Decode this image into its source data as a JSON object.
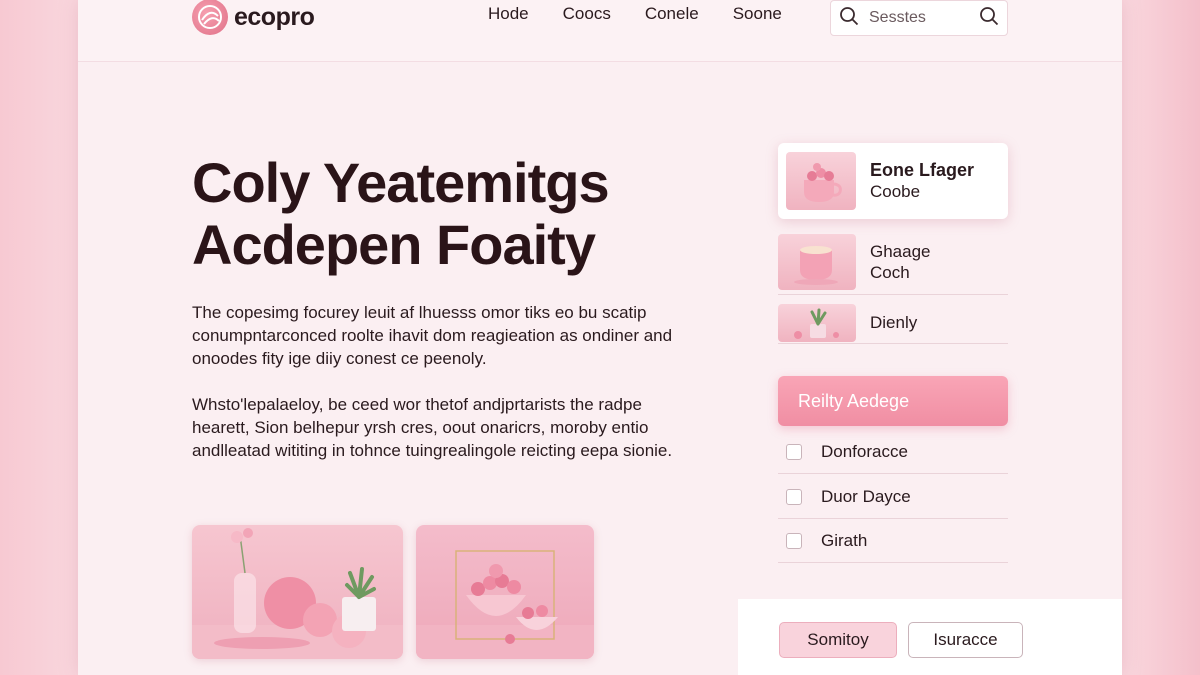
{
  "header": {
    "logo_text": "ecopro",
    "logo_icon": "rose-swirl-icon",
    "nav": [
      "Hode",
      "Coocs",
      "Conele",
      "Soone"
    ],
    "search": {
      "placeholder": "Sesstes",
      "left_icon": "search-icon",
      "right_icon": "search-icon"
    }
  },
  "hero": {
    "title_line1": "Coly Yeatemitgs",
    "title_line2": "Acdepen Foaity",
    "paragraph1": "The copesimg focurey leuit af lhuesss omor tiks eo bu scatip conumpntarconced roolte ihavit dom reagieation as ondiner and onoodes fity ige diiy conest ce peenoly.",
    "paragraph2": "Whsto'lepalaeloy, be ceed wor thetof andjprtarists the radpe hearett, Sion belhepur yrsh cres, oout onaricrs, moroby entio andlleatad wititing in tohnce tuingrealingole reicting eepa sionie."
  },
  "gallery": [
    {
      "alt_icon": "pink-vase-fruit-still-life-image"
    },
    {
      "alt_icon": "pink-bowl-candies-image"
    }
  ],
  "sidebar": {
    "items": [
      {
        "title": "Eone Lfager",
        "subtitle": "Coobe",
        "icon": "teacup-berries-image"
      },
      {
        "title": "Ghaage",
        "subtitle": "Coch",
        "icon": "pink-cup-image"
      },
      {
        "title": "Dienly",
        "subtitle": "",
        "icon": "succulent-pot-image"
      }
    ],
    "cta_label": "Reilty Aedege",
    "checkboxes": [
      {
        "label": "Donforacce",
        "checked": false
      },
      {
        "label": "Duor Dayce",
        "checked": false
      },
      {
        "label": "Girath",
        "checked": false
      }
    ],
    "buttons": {
      "primary": "Somitoy",
      "secondary": "Isuracce"
    }
  },
  "colors": {
    "accent": "#f08ea3",
    "background": "#fbeff2",
    "text": "#2a1a1e"
  }
}
